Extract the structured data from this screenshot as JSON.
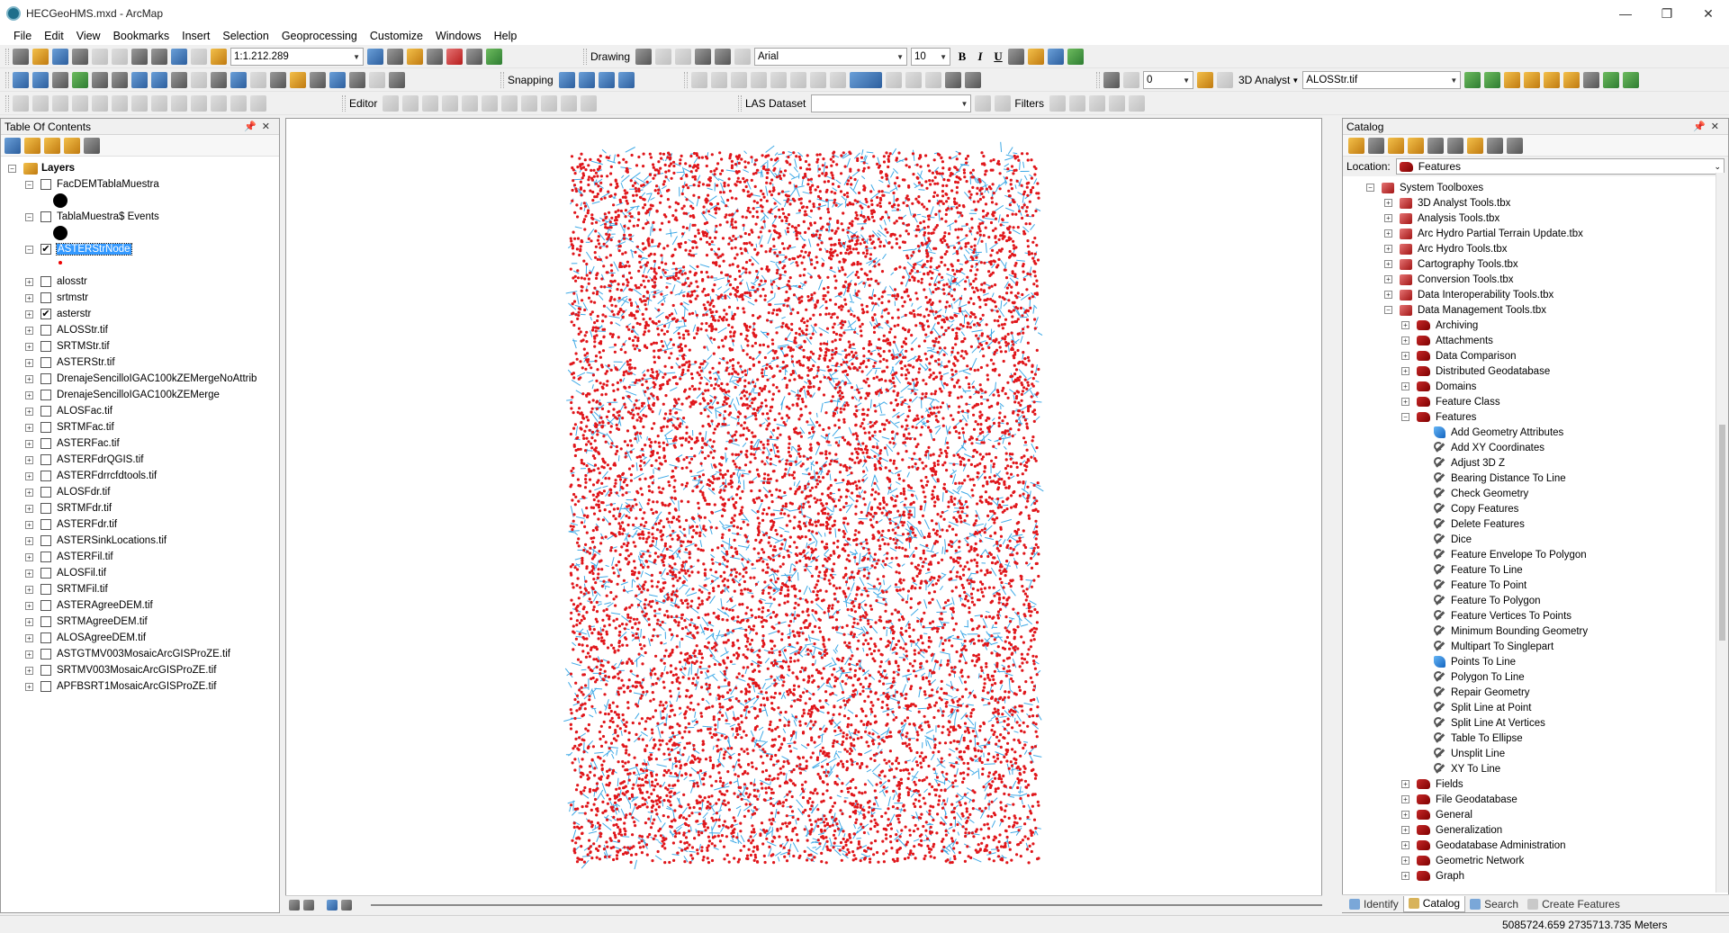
{
  "window": {
    "title": "HECGeoHMS.mxd - ArcMap",
    "controls": [
      "—",
      "❐",
      "✕"
    ]
  },
  "menu": [
    "File",
    "Edit",
    "View",
    "Bookmarks",
    "Insert",
    "Selection",
    "Geoprocessing",
    "Customize",
    "Windows",
    "Help"
  ],
  "toolbar": {
    "scale": "1:1.212.289",
    "drawing_label": "Drawing",
    "font_name": "Arial",
    "font_size": "10",
    "bold": "B",
    "italic": "I",
    "underline": "U",
    "snapping_label": "Snapping",
    "analyst_label": "3D Analyst",
    "analyst_layer": "ALOSStr.tif",
    "layer_index": "0",
    "editor_label": "Editor",
    "las_label": "LAS Dataset",
    "las_value": "",
    "filters_label": "Filters"
  },
  "toc": {
    "title": "Table Of Contents",
    "root": "Layers",
    "layers": [
      {
        "name": "FacDEMTablaMuestra",
        "checked": false,
        "expanded": true,
        "symbol": "black-dot"
      },
      {
        "name": "TablaMuestra$ Events",
        "checked": false,
        "expanded": true,
        "symbol": "black-dot"
      },
      {
        "name": "ASTERStrNode",
        "checked": true,
        "expanded": true,
        "symbol": "red-dot",
        "selected": true
      },
      {
        "name": "alosstr",
        "checked": false
      },
      {
        "name": "srtmstr",
        "checked": false
      },
      {
        "name": "asterstr",
        "checked": true
      },
      {
        "name": "ALOSStr.tif",
        "checked": false
      },
      {
        "name": "SRTMStr.tif",
        "checked": false
      },
      {
        "name": "ASTERStr.tif",
        "checked": false
      },
      {
        "name": "DrenajeSencilloIGAC100kZEMergeNoAttrib",
        "checked": false
      },
      {
        "name": "DrenajeSencilloIGAC100kZEMerge",
        "checked": false
      },
      {
        "name": "ALOSFac.tif",
        "checked": false
      },
      {
        "name": "SRTMFac.tif",
        "checked": false
      },
      {
        "name": "ASTERFac.tif",
        "checked": false
      },
      {
        "name": "ASTERFdrQGIS.tif",
        "checked": false
      },
      {
        "name": "ASTERFdrrcfdtools.tif",
        "checked": false
      },
      {
        "name": "ALOSFdr.tif",
        "checked": false
      },
      {
        "name": "SRTMFdr.tif",
        "checked": false
      },
      {
        "name": "ASTERFdr.tif",
        "checked": false
      },
      {
        "name": "ASTERSinkLocations.tif",
        "checked": false
      },
      {
        "name": "ASTERFil.tif",
        "checked": false
      },
      {
        "name": "ALOSFil.tif",
        "checked": false
      },
      {
        "name": "SRTMFil.tif",
        "checked": false
      },
      {
        "name": "ASTERAgreeDEM.tif",
        "checked": false
      },
      {
        "name": "SRTMAgreeDEM.tif",
        "checked": false
      },
      {
        "name": "ALOSAgreeDEM.tif",
        "checked": false
      },
      {
        "name": "ASTGTMV003MosaicArcGISProZE.tif",
        "checked": false
      },
      {
        "name": "SRTMV003MosaicArcGISProZE.tif",
        "checked": false
      },
      {
        "name": "APFBSRT1MosaicArcGISProZE.tif",
        "checked": false
      }
    ]
  },
  "map": {
    "point_color": "#e0161b",
    "stream_color": "#3ea9e6"
  },
  "catalog": {
    "title": "Catalog",
    "location_label": "Location:",
    "location_value": "Features",
    "items": [
      {
        "label": "System Toolboxes",
        "level": 0,
        "kind": "toolbox-folder",
        "exp": "−"
      },
      {
        "label": "3D Analyst Tools.tbx",
        "level": 1,
        "kind": "toolbox",
        "exp": "+"
      },
      {
        "label": "Analysis Tools.tbx",
        "level": 1,
        "kind": "toolbox",
        "exp": "+"
      },
      {
        "label": "Arc Hydro Partial Terrain Update.tbx",
        "level": 1,
        "kind": "toolbox",
        "exp": "+"
      },
      {
        "label": "Arc Hydro Tools.tbx",
        "level": 1,
        "kind": "toolbox",
        "exp": "+"
      },
      {
        "label": "Cartography Tools.tbx",
        "level": 1,
        "kind": "toolbox",
        "exp": "+"
      },
      {
        "label": "Conversion Tools.tbx",
        "level": 1,
        "kind": "toolbox",
        "exp": "+"
      },
      {
        "label": "Data Interoperability Tools.tbx",
        "level": 1,
        "kind": "toolbox",
        "exp": "+"
      },
      {
        "label": "Data Management Tools.tbx",
        "level": 1,
        "kind": "toolbox",
        "exp": "−"
      },
      {
        "label": "Archiving",
        "level": 2,
        "kind": "toolset",
        "exp": "+"
      },
      {
        "label": "Attachments",
        "level": 2,
        "kind": "toolset",
        "exp": "+"
      },
      {
        "label": "Data Comparison",
        "level": 2,
        "kind": "toolset",
        "exp": "+"
      },
      {
        "label": "Distributed Geodatabase",
        "level": 2,
        "kind": "toolset",
        "exp": "+"
      },
      {
        "label": "Domains",
        "level": 2,
        "kind": "toolset",
        "exp": "+"
      },
      {
        "label": "Feature Class",
        "level": 2,
        "kind": "toolset",
        "exp": "+"
      },
      {
        "label": "Features",
        "level": 2,
        "kind": "toolset",
        "exp": "−",
        "selected": true
      },
      {
        "label": "Add Geometry Attributes",
        "level": 3,
        "kind": "script"
      },
      {
        "label": "Add XY Coordinates",
        "level": 3,
        "kind": "tool"
      },
      {
        "label": "Adjust 3D Z",
        "level": 3,
        "kind": "tool"
      },
      {
        "label": "Bearing Distance To Line",
        "level": 3,
        "kind": "tool"
      },
      {
        "label": "Check Geometry",
        "level": 3,
        "kind": "tool"
      },
      {
        "label": "Copy Features",
        "level": 3,
        "kind": "tool"
      },
      {
        "label": "Delete Features",
        "level": 3,
        "kind": "tool"
      },
      {
        "label": "Dice",
        "level": 3,
        "kind": "tool"
      },
      {
        "label": "Feature Envelope To Polygon",
        "level": 3,
        "kind": "tool"
      },
      {
        "label": "Feature To Line",
        "level": 3,
        "kind": "tool"
      },
      {
        "label": "Feature To Point",
        "level": 3,
        "kind": "tool"
      },
      {
        "label": "Feature To Polygon",
        "level": 3,
        "kind": "tool"
      },
      {
        "label": "Feature Vertices To Points",
        "level": 3,
        "kind": "tool"
      },
      {
        "label": "Minimum Bounding Geometry",
        "level": 3,
        "kind": "tool"
      },
      {
        "label": "Multipart To Singlepart",
        "level": 3,
        "kind": "tool"
      },
      {
        "label": "Points To Line",
        "level": 3,
        "kind": "script"
      },
      {
        "label": "Polygon To Line",
        "level": 3,
        "kind": "tool"
      },
      {
        "label": "Repair Geometry",
        "level": 3,
        "kind": "tool"
      },
      {
        "label": "Split Line at Point",
        "level": 3,
        "kind": "tool"
      },
      {
        "label": "Split Line At Vertices",
        "level": 3,
        "kind": "tool"
      },
      {
        "label": "Table To Ellipse",
        "level": 3,
        "kind": "tool"
      },
      {
        "label": "Unsplit Line",
        "level": 3,
        "kind": "tool"
      },
      {
        "label": "XY To Line",
        "level": 3,
        "kind": "tool"
      },
      {
        "label": "Fields",
        "level": 2,
        "kind": "toolset",
        "exp": "+"
      },
      {
        "label": "File Geodatabase",
        "level": 2,
        "kind": "toolset",
        "exp": "+"
      },
      {
        "label": "General",
        "level": 2,
        "kind": "toolset",
        "exp": "+"
      },
      {
        "label": "Generalization",
        "level": 2,
        "kind": "toolset",
        "exp": "+"
      },
      {
        "label": "Geodatabase Administration",
        "level": 2,
        "kind": "toolset",
        "exp": "+"
      },
      {
        "label": "Geometric Network",
        "level": 2,
        "kind": "toolset",
        "exp": "+"
      },
      {
        "label": "Graph",
        "level": 2,
        "kind": "toolset",
        "exp": "+"
      }
    ],
    "tabs": [
      "Identify",
      "Catalog",
      "Search",
      "Create Features"
    ]
  },
  "status": {
    "coordinates": "5085724.659  2735713.735 Meters"
  }
}
